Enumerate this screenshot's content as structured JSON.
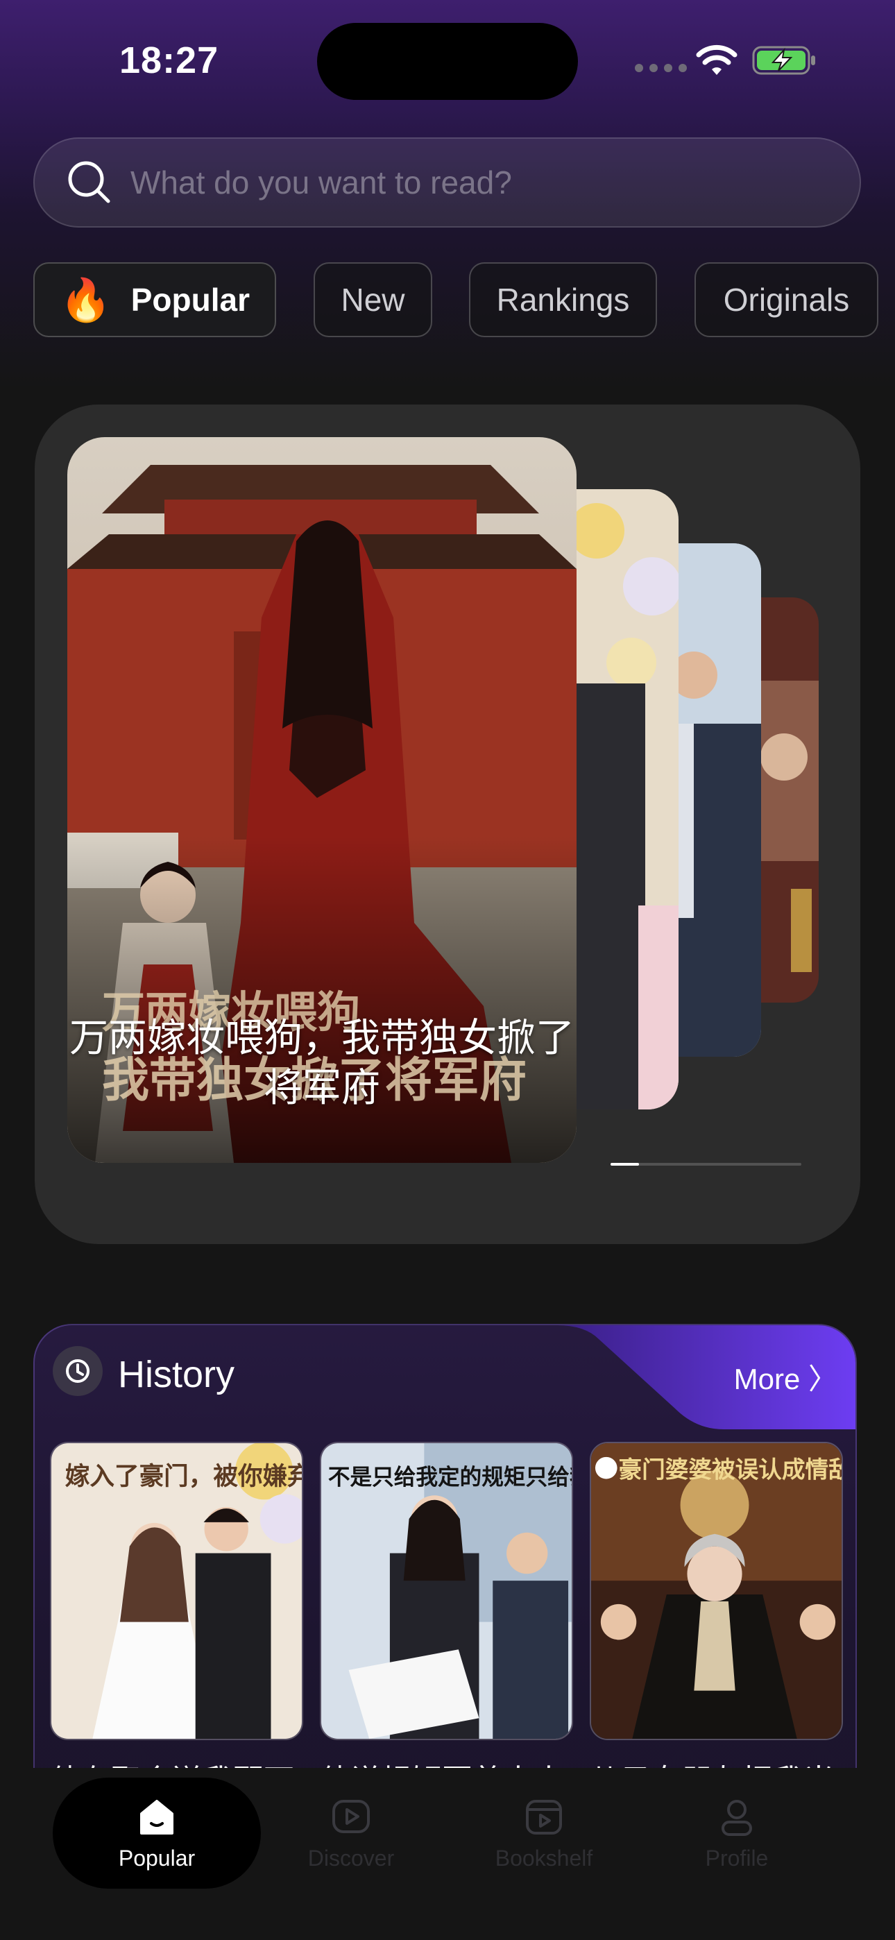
{
  "status": {
    "time": "18:27"
  },
  "search": {
    "placeholder": "What do you want to read?"
  },
  "tabs": [
    {
      "label": "Popular",
      "icon": "fire-icon",
      "active": true
    },
    {
      "label": "New"
    },
    {
      "label": "Rankings"
    },
    {
      "label": "Originals"
    }
  ],
  "carousel": {
    "featured_title": "万两嫁妆喂狗，我带独女掀了将军府",
    "cover_text_line1": "万两嫁妆喂狗",
    "cover_text_line2": "我带独女掀了将军府",
    "progress": 0.15
  },
  "history": {
    "title": "History",
    "more": "More 〉",
    "books": [
      {
        "title": "他在聚会送我配下",
        "cover_text": "嫁入了豪门，被你嫌弃的女孩"
      },
      {
        "title": "他说规矩要着人人",
        "cover_text": "不是只给我定的规矩只给我定的"
      },
      {
        "title": "儿子女朋友把我当",
        "cover_text": "豪门婆婆被误认成情敌·霸气打脸"
      }
    ]
  },
  "nav": [
    {
      "label": "Popular",
      "icon": "home-icon",
      "active": true
    },
    {
      "label": "Discover",
      "icon": "play-icon"
    },
    {
      "label": "Bookshelf",
      "icon": "bookshelf-icon"
    },
    {
      "label": "Profile",
      "icon": "profile-icon"
    }
  ],
  "colors": {
    "accent": "#7b4cf0",
    "background": "#151515",
    "header_purple": "#3e1f6e"
  }
}
